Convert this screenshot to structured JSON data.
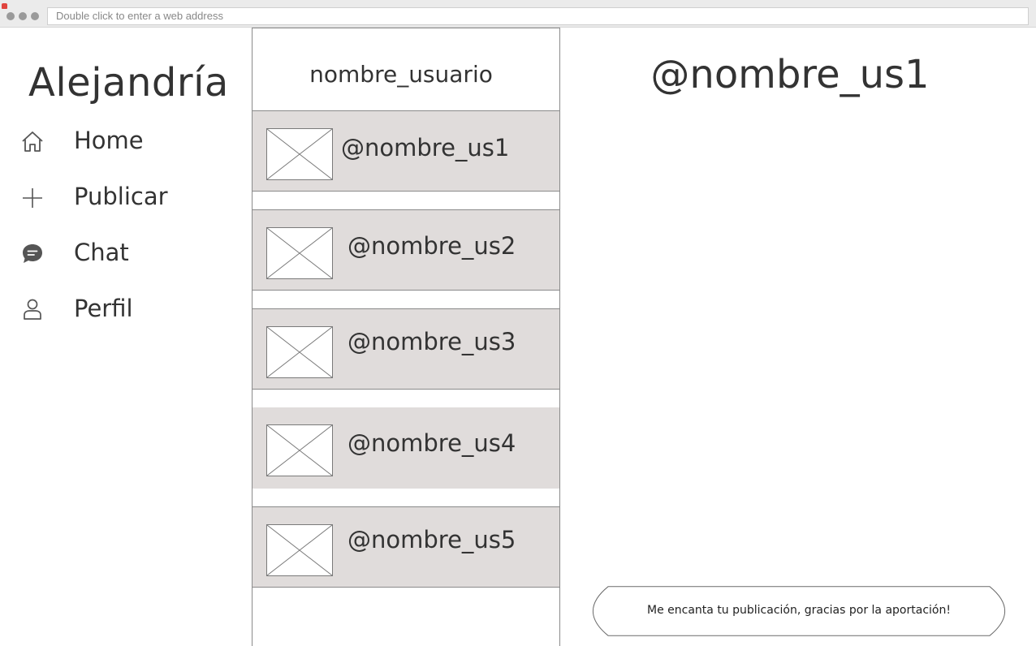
{
  "browser": {
    "address_placeholder": "Double click to enter a web address"
  },
  "sidebar": {
    "brand": "Alejandría",
    "items": [
      {
        "label": "Home",
        "icon": "home-icon"
      },
      {
        "label": "Publicar",
        "icon": "plus-icon"
      },
      {
        "label": "Chat",
        "icon": "chat-icon"
      },
      {
        "label": "Perfil",
        "icon": "user-icon"
      }
    ]
  },
  "conversations": {
    "title": "nombre_usuario",
    "items": [
      {
        "handle": "@nombre_us1",
        "avatar": "image-placeholder-icon"
      },
      {
        "handle": "@nombre_us2",
        "avatar": "image-placeholder-icon"
      },
      {
        "handle": "@nombre_us3",
        "avatar": "image-placeholder-icon"
      },
      {
        "handle": "@nombre_us4",
        "avatar": "image-placeholder-icon"
      },
      {
        "handle": "@nombre_us5",
        "avatar": "image-placeholder-icon"
      }
    ]
  },
  "chat": {
    "title": "@nombre_us1",
    "messages": [
      {
        "text": "Me encanta tu publicación, gracias por la aportación!"
      }
    ]
  },
  "colors": {
    "row_background": "#e0dcdb",
    "border": "#8a8a8a",
    "text": "#333333"
  }
}
